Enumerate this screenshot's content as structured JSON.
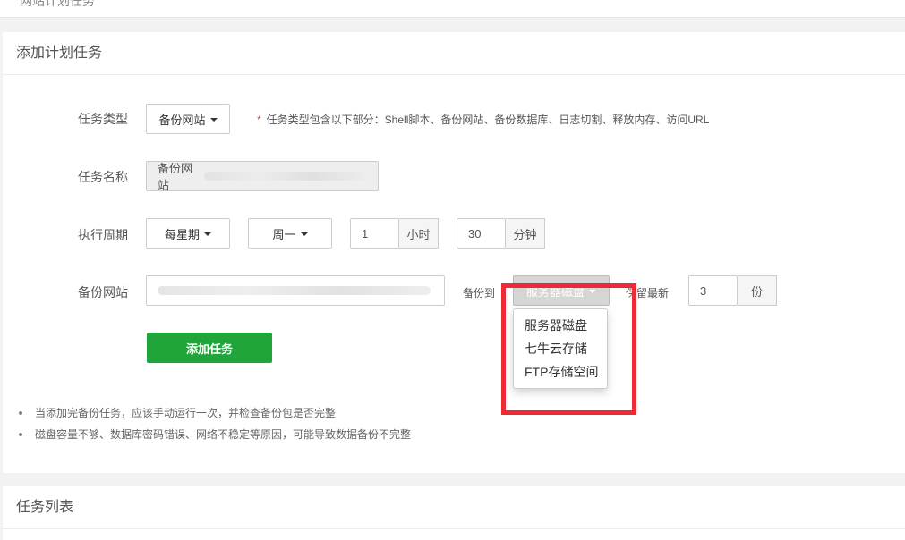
{
  "top_section": {
    "title_fragment": "网站计划任务"
  },
  "add_panel": {
    "title": "添加计划任务",
    "task_type": {
      "label": "任务类型",
      "selected": "备份网站",
      "hint": "任务类型包含以下部分：Shell脚本、备份网站、备份数据库、日志切割、释放内存、访问URL",
      "required_mark": "*"
    },
    "task_name": {
      "label": "任务名称",
      "value": "备份网站"
    },
    "cycle": {
      "label": "执行周期",
      "period": "每星期",
      "weekday": "周一",
      "hour_value": "1",
      "hour_unit": "小时",
      "minute_value": "30",
      "minute_unit": "分钟"
    },
    "backup_site": {
      "label": "备份网站",
      "backup_to_label": "备份到",
      "backup_to_selected": "服务器磁盘",
      "keep_label": "保留最新",
      "keep_value": "3",
      "keep_unit": "份"
    },
    "backup_to_menu": [
      "服务器磁盘",
      "七牛云存储",
      "FTP存储空间"
    ],
    "submit_label": "添加任务",
    "notes": [
      "当添加完备份任务，应该手动运行一次，并检查备份包是否完整",
      "磁盘容量不够、数据库密码错误、网络不稳定等原因，可能导致数据备份不完整"
    ]
  },
  "list_panel": {
    "title": "任务列表"
  },
  "colors": {
    "accent_green": "#20a53a",
    "highlight_red": "#ee2b35",
    "required_red": "#e74c3c"
  }
}
